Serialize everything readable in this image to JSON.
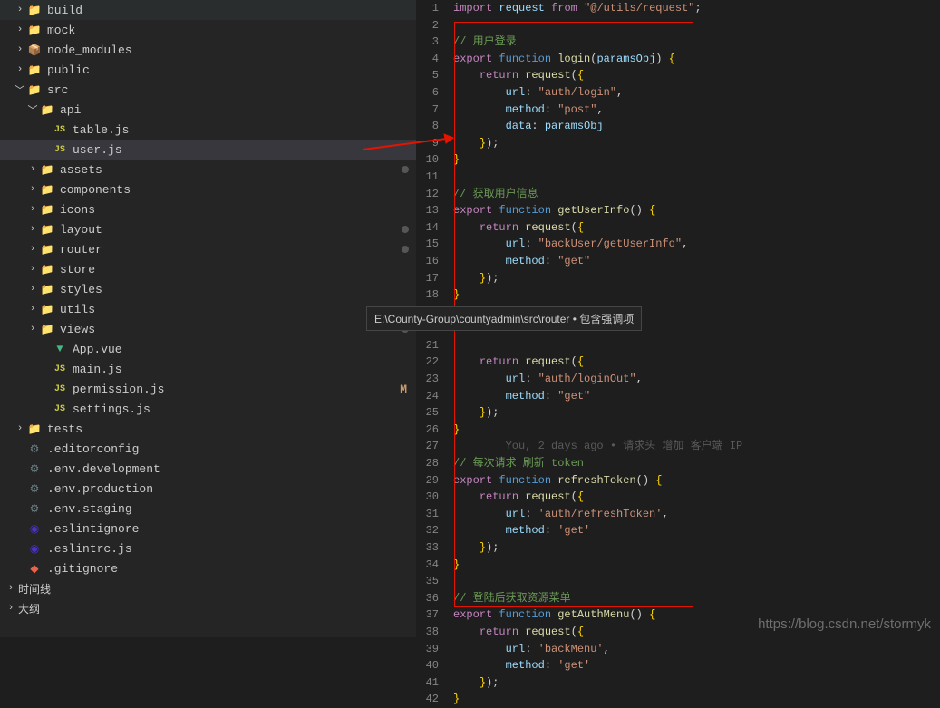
{
  "sidebar": {
    "tree": [
      {
        "indent": 1,
        "chev": "right",
        "icon": "folder",
        "label": "build"
      },
      {
        "indent": 1,
        "chev": "right",
        "icon": "folder",
        "label": "mock"
      },
      {
        "indent": 1,
        "chev": "right",
        "icon": "module",
        "label": "node_modules"
      },
      {
        "indent": 1,
        "chev": "right",
        "icon": "folder",
        "label": "public"
      },
      {
        "indent": 1,
        "chev": "down",
        "icon": "folder-green",
        "label": "src"
      },
      {
        "indent": 2,
        "chev": "down",
        "icon": "folder-teal",
        "label": "api"
      },
      {
        "indent": 3,
        "chev": "",
        "icon": "js",
        "label": "table.js"
      },
      {
        "indent": 3,
        "chev": "",
        "icon": "js",
        "label": "user.js",
        "selected": true
      },
      {
        "indent": 2,
        "chev": "right",
        "icon": "folder-orange",
        "label": "assets",
        "dot": true
      },
      {
        "indent": 2,
        "chev": "right",
        "icon": "folder-teal",
        "label": "components"
      },
      {
        "indent": 2,
        "chev": "right",
        "icon": "folder-teal",
        "label": "icons"
      },
      {
        "indent": 2,
        "chev": "right",
        "icon": "folder-orange",
        "label": "layout",
        "dot": true
      },
      {
        "indent": 2,
        "chev": "right",
        "icon": "folder",
        "label": "router",
        "dot": true
      },
      {
        "indent": 2,
        "chev": "right",
        "icon": "folder-teal",
        "label": "store"
      },
      {
        "indent": 2,
        "chev": "right",
        "icon": "folder-blue",
        "label": "styles"
      },
      {
        "indent": 2,
        "chev": "right",
        "icon": "folder-orange",
        "label": "utils",
        "dot": true
      },
      {
        "indent": 2,
        "chev": "right",
        "icon": "folder-orange",
        "label": "views",
        "dot": true
      },
      {
        "indent": 3,
        "chev": "",
        "icon": "vue",
        "label": "App.vue"
      },
      {
        "indent": 3,
        "chev": "",
        "icon": "js",
        "label": "main.js"
      },
      {
        "indent": 3,
        "chev": "",
        "icon": "js",
        "label": "permission.js",
        "status": "M"
      },
      {
        "indent": 3,
        "chev": "",
        "icon": "js",
        "label": "settings.js"
      },
      {
        "indent": 1,
        "chev": "right",
        "icon": "folder-teal",
        "label": "tests"
      },
      {
        "indent": 1,
        "chev": "",
        "icon": "editorconfig",
        "label": ".editorconfig"
      },
      {
        "indent": 1,
        "chev": "",
        "icon": "gear",
        "label": ".env.development"
      },
      {
        "indent": 1,
        "chev": "",
        "icon": "gear",
        "label": ".env.production"
      },
      {
        "indent": 1,
        "chev": "",
        "icon": "gear",
        "label": ".env.staging"
      },
      {
        "indent": 1,
        "chev": "",
        "icon": "eslint",
        "label": ".eslintignore"
      },
      {
        "indent": 1,
        "chev": "",
        "icon": "eslint",
        "label": ".eslintrc.js"
      },
      {
        "indent": 1,
        "chev": "",
        "icon": "git",
        "label": ".gitignore"
      }
    ],
    "sections": [
      {
        "label": "时间线",
        "chev": "right"
      },
      {
        "label": "大纲",
        "chev": "right"
      }
    ]
  },
  "tooltip": "E:\\County-Group\\countyadmin\\src\\router • 包含强调项",
  "code": {
    "startLine": 1,
    "inlineHint": "You, 2 days ago • 请求头 增加 客户端 IP",
    "lines": [
      [
        {
          "t": "kw",
          "v": "import"
        },
        {
          "t": "par",
          "v": " "
        },
        {
          "t": "prop",
          "v": "request"
        },
        {
          "t": "par",
          "v": " "
        },
        {
          "t": "kw",
          "v": "from"
        },
        {
          "t": "par",
          "v": " "
        },
        {
          "t": "str",
          "v": "\"@/utils/request\""
        },
        {
          "t": "par",
          "v": ";"
        }
      ],
      [],
      [
        {
          "t": "cm",
          "v": "// 用户登录"
        }
      ],
      [
        {
          "t": "kw",
          "v": "export"
        },
        {
          "t": "par",
          "v": " "
        },
        {
          "t": "kw2",
          "v": "function"
        },
        {
          "t": "par",
          "v": " "
        },
        {
          "t": "fn",
          "v": "login"
        },
        {
          "t": "par",
          "v": "("
        },
        {
          "t": "prop",
          "v": "paramsObj"
        },
        {
          "t": "par",
          "v": ") "
        },
        {
          "t": "br",
          "v": "{"
        }
      ],
      [
        {
          "t": "par",
          "v": "    "
        },
        {
          "t": "kw",
          "v": "return"
        },
        {
          "t": "par",
          "v": " "
        },
        {
          "t": "fn",
          "v": "request"
        },
        {
          "t": "par",
          "v": "("
        },
        {
          "t": "br",
          "v": "{"
        }
      ],
      [
        {
          "t": "par",
          "v": "        "
        },
        {
          "t": "prop",
          "v": "url"
        },
        {
          "t": "par",
          "v": ": "
        },
        {
          "t": "str",
          "v": "\"auth/login\""
        },
        {
          "t": "par",
          "v": ","
        }
      ],
      [
        {
          "t": "par",
          "v": "        "
        },
        {
          "t": "prop",
          "v": "method"
        },
        {
          "t": "par",
          "v": ": "
        },
        {
          "t": "str",
          "v": "\"post\""
        },
        {
          "t": "par",
          "v": ","
        }
      ],
      [
        {
          "t": "par",
          "v": "        "
        },
        {
          "t": "prop",
          "v": "data"
        },
        {
          "t": "par",
          "v": ": "
        },
        {
          "t": "prop",
          "v": "paramsObj"
        }
      ],
      [
        {
          "t": "par",
          "v": "    "
        },
        {
          "t": "br",
          "v": "}"
        },
        {
          "t": "par",
          "v": ");"
        }
      ],
      [
        {
          "t": "br",
          "v": "}"
        }
      ],
      [],
      [
        {
          "t": "cm",
          "v": "// 获取用户信息"
        }
      ],
      [
        {
          "t": "kw",
          "v": "export"
        },
        {
          "t": "par",
          "v": " "
        },
        {
          "t": "kw2",
          "v": "function"
        },
        {
          "t": "par",
          "v": " "
        },
        {
          "t": "fn",
          "v": "getUserInfo"
        },
        {
          "t": "par",
          "v": "() "
        },
        {
          "t": "br",
          "v": "{"
        }
      ],
      [
        {
          "t": "par",
          "v": "    "
        },
        {
          "t": "kw",
          "v": "return"
        },
        {
          "t": "par",
          "v": " "
        },
        {
          "t": "fn",
          "v": "request"
        },
        {
          "t": "par",
          "v": "("
        },
        {
          "t": "br",
          "v": "{"
        }
      ],
      [
        {
          "t": "par",
          "v": "        "
        },
        {
          "t": "prop",
          "v": "url"
        },
        {
          "t": "par",
          "v": ": "
        },
        {
          "t": "str",
          "v": "\"backUser/getUserInfo\""
        },
        {
          "t": "par",
          "v": ","
        }
      ],
      [
        {
          "t": "par",
          "v": "        "
        },
        {
          "t": "prop",
          "v": "method"
        },
        {
          "t": "par",
          "v": ": "
        },
        {
          "t": "str",
          "v": "\"get\""
        }
      ],
      [
        {
          "t": "par",
          "v": "    "
        },
        {
          "t": "br",
          "v": "}"
        },
        {
          "t": "par",
          "v": ");"
        }
      ],
      [
        {
          "t": "br",
          "v": "}"
        }
      ],
      [],
      [],
      [],
      [
        {
          "t": "par",
          "v": "    "
        },
        {
          "t": "kw",
          "v": "return"
        },
        {
          "t": "par",
          "v": " "
        },
        {
          "t": "fn",
          "v": "request"
        },
        {
          "t": "par",
          "v": "("
        },
        {
          "t": "br",
          "v": "{"
        }
      ],
      [
        {
          "t": "par",
          "v": "        "
        },
        {
          "t": "prop",
          "v": "url"
        },
        {
          "t": "par",
          "v": ": "
        },
        {
          "t": "str",
          "v": "\"auth/loginOut\""
        },
        {
          "t": "par",
          "v": ","
        }
      ],
      [
        {
          "t": "par",
          "v": "        "
        },
        {
          "t": "prop",
          "v": "method"
        },
        {
          "t": "par",
          "v": ": "
        },
        {
          "t": "str",
          "v": "\"get\""
        }
      ],
      [
        {
          "t": "par",
          "v": "    "
        },
        {
          "t": "br",
          "v": "}"
        },
        {
          "t": "par",
          "v": ");"
        }
      ],
      [
        {
          "t": "br",
          "v": "}"
        }
      ],
      [
        {
          "t": "hint",
          "v": "        "
        }
      ],
      [
        {
          "t": "cm",
          "v": "// 每次请求 刷新 token"
        }
      ],
      [
        {
          "t": "kw",
          "v": "export"
        },
        {
          "t": "par",
          "v": " "
        },
        {
          "t": "kw2",
          "v": "function"
        },
        {
          "t": "par",
          "v": " "
        },
        {
          "t": "fn",
          "v": "refreshToken"
        },
        {
          "t": "par",
          "v": "() "
        },
        {
          "t": "br",
          "v": "{"
        }
      ],
      [
        {
          "t": "par",
          "v": "    "
        },
        {
          "t": "kw",
          "v": "return"
        },
        {
          "t": "par",
          "v": " "
        },
        {
          "t": "fn",
          "v": "request"
        },
        {
          "t": "par",
          "v": "("
        },
        {
          "t": "br",
          "v": "{"
        }
      ],
      [
        {
          "t": "par",
          "v": "        "
        },
        {
          "t": "prop",
          "v": "url"
        },
        {
          "t": "par",
          "v": ": "
        },
        {
          "t": "str",
          "v": "'auth/refreshToken'"
        },
        {
          "t": "par",
          "v": ","
        }
      ],
      [
        {
          "t": "par",
          "v": "        "
        },
        {
          "t": "prop",
          "v": "method"
        },
        {
          "t": "par",
          "v": ": "
        },
        {
          "t": "str",
          "v": "'get'"
        }
      ],
      [
        {
          "t": "par",
          "v": "    "
        },
        {
          "t": "br",
          "v": "}"
        },
        {
          "t": "par",
          "v": ");"
        }
      ],
      [
        {
          "t": "br",
          "v": "}"
        }
      ],
      [],
      [
        {
          "t": "cm",
          "v": "// 登陆后获取资源菜单"
        }
      ],
      [
        {
          "t": "kw",
          "v": "export"
        },
        {
          "t": "par",
          "v": " "
        },
        {
          "t": "kw2",
          "v": "function"
        },
        {
          "t": "par",
          "v": " "
        },
        {
          "t": "fn",
          "v": "getAuthMenu"
        },
        {
          "t": "par",
          "v": "() "
        },
        {
          "t": "br",
          "v": "{"
        }
      ],
      [
        {
          "t": "par",
          "v": "    "
        },
        {
          "t": "kw",
          "v": "return"
        },
        {
          "t": "par",
          "v": " "
        },
        {
          "t": "fn",
          "v": "request"
        },
        {
          "t": "par",
          "v": "("
        },
        {
          "t": "br",
          "v": "{"
        }
      ],
      [
        {
          "t": "par",
          "v": "        "
        },
        {
          "t": "prop",
          "v": "url"
        },
        {
          "t": "par",
          "v": ": "
        },
        {
          "t": "str",
          "v": "'backMenu'"
        },
        {
          "t": "par",
          "v": ","
        }
      ],
      [
        {
          "t": "par",
          "v": "        "
        },
        {
          "t": "prop",
          "v": "method"
        },
        {
          "t": "par",
          "v": ": "
        },
        {
          "t": "str",
          "v": "'get'"
        }
      ],
      [
        {
          "t": "par",
          "v": "    "
        },
        {
          "t": "br",
          "v": "}"
        },
        {
          "t": "par",
          "v": ");"
        }
      ],
      [
        {
          "t": "br",
          "v": "}"
        }
      ]
    ]
  },
  "watermark": "https://blog.csdn.net/stormyk"
}
